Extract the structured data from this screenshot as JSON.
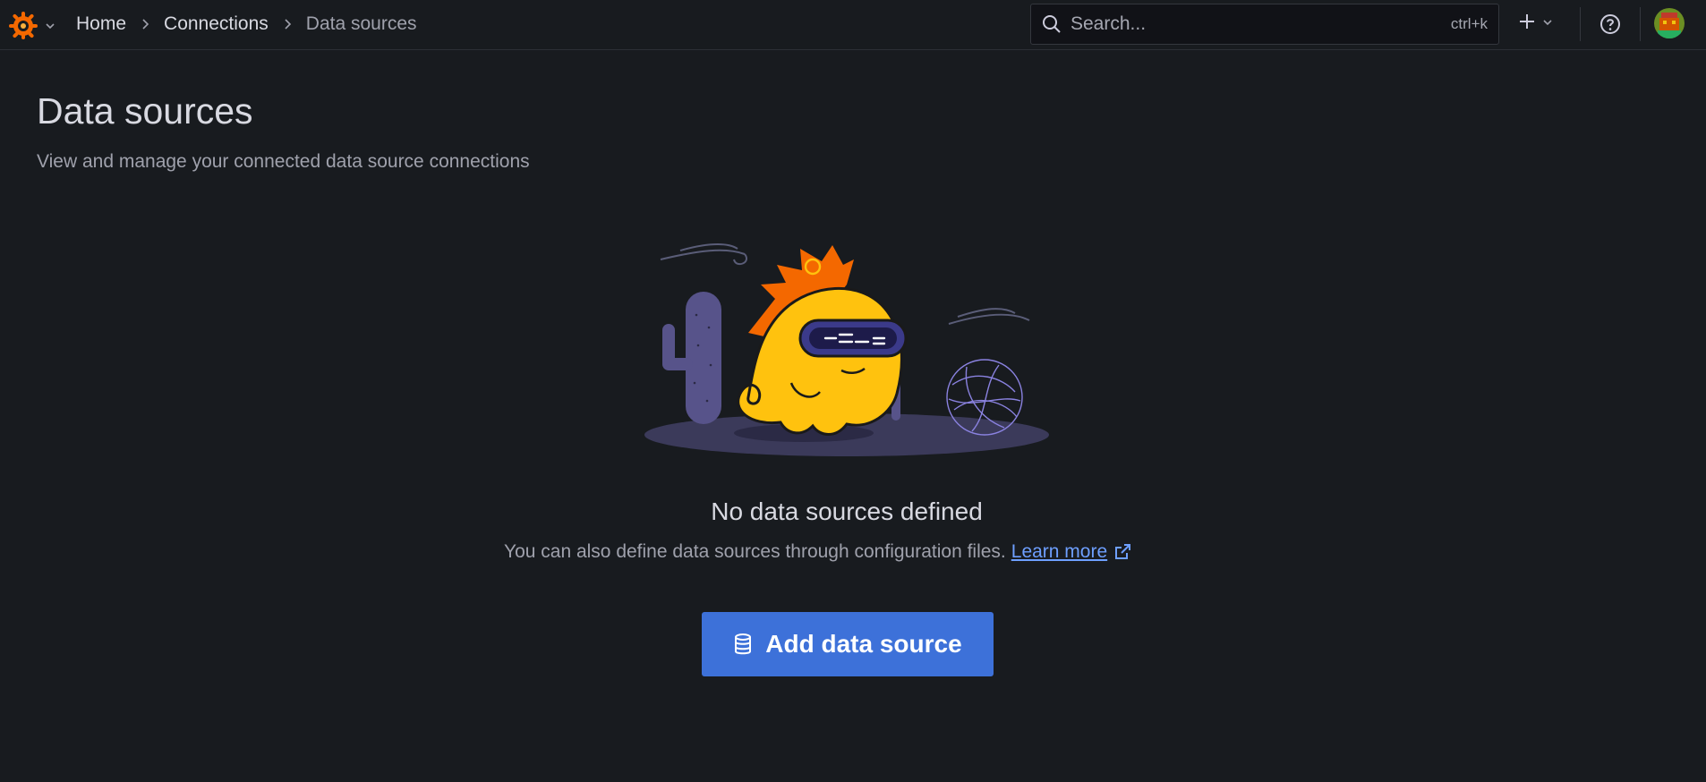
{
  "header": {
    "breadcrumb": [
      {
        "label": "Home"
      },
      {
        "label": "Connections"
      },
      {
        "label": "Data sources"
      }
    ],
    "search": {
      "placeholder": "Search...",
      "shortcut": "ctrl+k"
    },
    "icons": {
      "logo": "grafana-logo-icon",
      "new": "plus-icon",
      "help": "help-circle-icon"
    }
  },
  "page": {
    "title": "Data sources",
    "subtitle": "View and manage your connected data source connections"
  },
  "empty_state": {
    "title": "No data sources defined",
    "description": "You can also define data sources through configuration files.",
    "learn_more": "Learn more",
    "button": "Add data source"
  },
  "colors": {
    "background": "#181b1f",
    "primary_button": "#3d71d9",
    "link": "#6e9fff",
    "logo_orange": "#f46800",
    "mascot_yellow": "#ffc20e"
  }
}
